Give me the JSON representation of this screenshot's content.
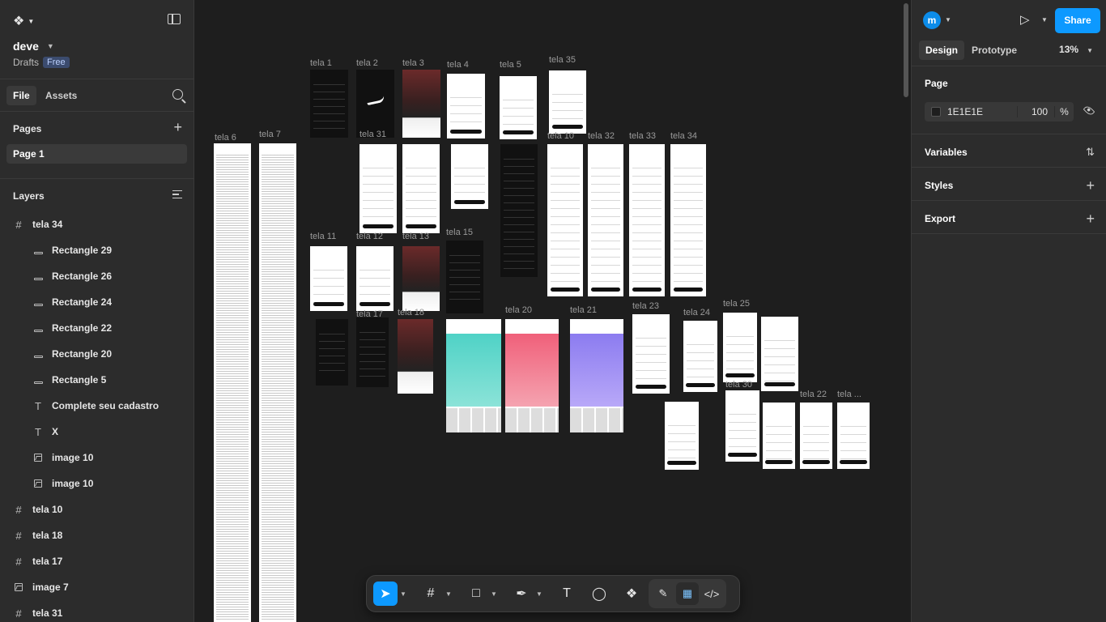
{
  "left_panel": {
    "project_name": "deve",
    "drafts_label": "Drafts",
    "plan_badge": "Free",
    "tabs": {
      "file": "File",
      "assets": "Assets"
    },
    "pages_heading": "Pages",
    "pages": [
      "Page 1"
    ],
    "layers_heading": "Layers",
    "layers": [
      {
        "name": "tela 34",
        "type": "frame"
      },
      {
        "name": "Rectangle 29",
        "type": "rect"
      },
      {
        "name": "Rectangle 26",
        "type": "rect"
      },
      {
        "name": "Rectangle 24",
        "type": "rect"
      },
      {
        "name": "Rectangle 22",
        "type": "rect"
      },
      {
        "name": "Rectangle 20",
        "type": "rect"
      },
      {
        "name": "Rectangle 5",
        "type": "rect"
      },
      {
        "name": "Complete seu cadastro",
        "type": "text"
      },
      {
        "name": "X",
        "type": "text"
      },
      {
        "name": "image 10",
        "type": "image"
      },
      {
        "name": "image 10",
        "type": "image"
      },
      {
        "name": "tela 10",
        "type": "frame"
      },
      {
        "name": "tela 18",
        "type": "frame"
      },
      {
        "name": "tela 17",
        "type": "frame"
      },
      {
        "name": "image 7",
        "type": "image"
      },
      {
        "name": "tela 31",
        "type": "frame"
      }
    ]
  },
  "canvas": {
    "frames": [
      {
        "label": "tela 1"
      },
      {
        "label": "tela 2"
      },
      {
        "label": "tela 3"
      },
      {
        "label": "tela 4"
      },
      {
        "label": "tela 5"
      },
      {
        "label": "tela 35"
      },
      {
        "label": "tela 6"
      },
      {
        "label": "tela 7"
      },
      {
        "label": "tela 31"
      },
      {
        "label": "tela 10"
      },
      {
        "label": "tela 32"
      },
      {
        "label": "tela 33"
      },
      {
        "label": "tela 34"
      },
      {
        "label": "tela 11"
      },
      {
        "label": "tela 12"
      },
      {
        "label": "tela 13"
      },
      {
        "label": "tela 15"
      },
      {
        "label": "tela 17"
      },
      {
        "label": "tela 18"
      },
      {
        "label": "tela 20"
      },
      {
        "label": "tela 21"
      },
      {
        "label": "tela 23"
      },
      {
        "label": "tela 24"
      },
      {
        "label": "tela 25"
      },
      {
        "label": "tela 30"
      },
      {
        "label": "tela 22"
      },
      {
        "label": "tela ..."
      },
      {
        "label": "tela ..."
      }
    ]
  },
  "toolbar": {
    "tools": [
      "move-tool",
      "frame-tool",
      "shape-tool",
      "pen-tool",
      "text-tool",
      "comment-tool",
      "actions-tool"
    ],
    "modes": [
      "draw-mode",
      "design-mode",
      "dev-mode"
    ]
  },
  "right_panel": {
    "avatar_letter": "m",
    "share_label": "Share",
    "tabs": {
      "design": "Design",
      "prototype": "Prototype"
    },
    "zoom": "13%",
    "page_heading": "Page",
    "page_color": "1E1E1E",
    "page_opacity": "100",
    "percent_sign": "%",
    "variables": "Variables",
    "styles": "Styles",
    "export": "Export"
  },
  "help_label": "?"
}
